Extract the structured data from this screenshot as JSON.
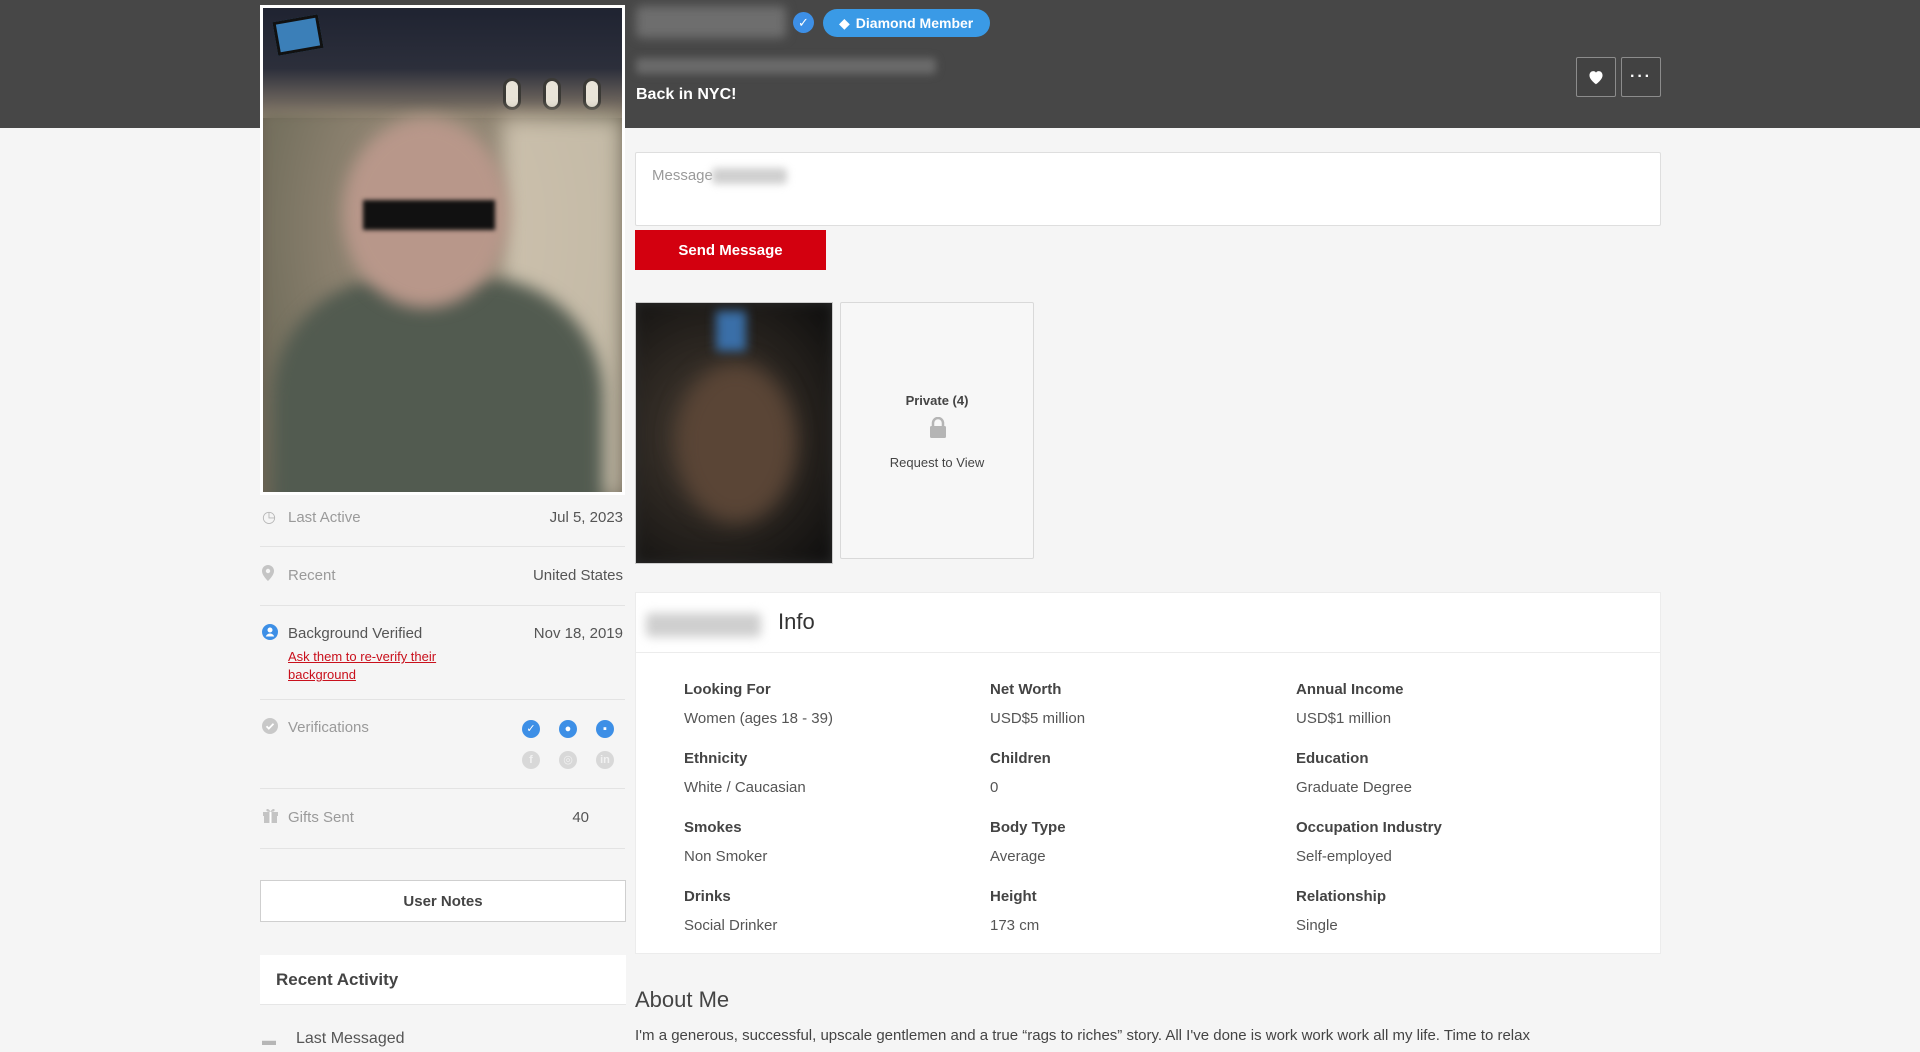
{
  "header": {
    "member_badge": "Diamond Member",
    "headline": "Back in NYC!"
  },
  "message": {
    "placeholder": "Message",
    "send_label": "Send Message"
  },
  "stats": {
    "last_active_label": "Last Active",
    "last_active_value": "Jul 5, 2023",
    "recent_label": "Recent",
    "recent_value": "United States",
    "background_label": "Background Verified",
    "background_value": "Nov 18, 2019",
    "reverify_link": "Ask them to re-verify their background",
    "verifications_label": "Verifications",
    "gifts_label": "Gifts Sent",
    "gifts_value": "40"
  },
  "sidebar": {
    "user_notes": "User Notes",
    "recent_activity": "Recent Activity",
    "last_messaged": "Last Messaged"
  },
  "gallery": {
    "private_label": "Private (4)",
    "request_label": "Request to View"
  },
  "info": {
    "title": "Info",
    "items": [
      {
        "label": "Looking For",
        "value": "Women (ages 18 - 39)"
      },
      {
        "label": "Net Worth",
        "value": "USD$5 million"
      },
      {
        "label": "Annual Income",
        "value": "USD$1 million"
      },
      {
        "label": "Ethnicity",
        "value": "White / Caucasian"
      },
      {
        "label": "Children",
        "value": "0"
      },
      {
        "label": "Education",
        "value": "Graduate Degree"
      },
      {
        "label": "Smokes",
        "value": "Non Smoker"
      },
      {
        "label": "Body Type",
        "value": "Average"
      },
      {
        "label": "Occupation Industry",
        "value": "Self-employed"
      },
      {
        "label": "Drinks",
        "value": "Social Drinker"
      },
      {
        "label": "Height",
        "value": "173 cm"
      },
      {
        "label": "Relationship",
        "value": "Single"
      }
    ]
  },
  "about": {
    "title": "About Me",
    "text": "I'm a generous, successful, upscale gentlemen and a true “rags to riches” story. All I've done is work work work all my life. Time to relax"
  },
  "icons": {
    "verified": "check-badge-icon",
    "favorite": "heart-icon",
    "more": "ellipsis-icon",
    "lock": "lock-icon",
    "location": "pin-icon",
    "clock": "clock-icon",
    "gift": "gift-icon"
  },
  "colors": {
    "topbar": "#474747",
    "accent_red": "#d3000f",
    "badge_blue": "#3a9ae6",
    "link_red": "#c9101c"
  }
}
